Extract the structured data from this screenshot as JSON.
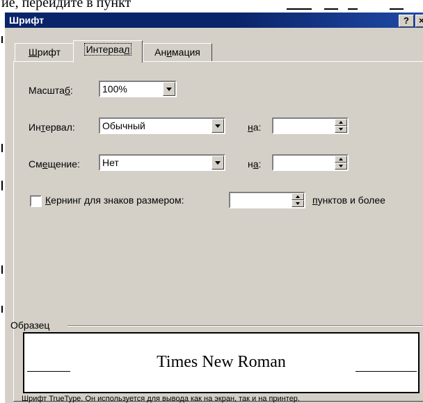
{
  "document": {
    "background_fragment": "ие, перейдите в пункт"
  },
  "dialog": {
    "title": "Шрифт",
    "help_glyph": "?",
    "close_glyph": "×"
  },
  "tabs": [
    {
      "label_pre": "",
      "label_u": "Ш",
      "label_post": "рифт",
      "active": false
    },
    {
      "label_pre": "Интерва",
      "label_u": "л",
      "label_post": "",
      "active": true
    },
    {
      "label_pre": "Ан",
      "label_u": "и",
      "label_post": "мация",
      "active": false
    }
  ],
  "scale": {
    "label_pre": "Масшта",
    "label_u": "б",
    "label_post": ":",
    "value": "100%"
  },
  "spacing": {
    "label_pre": "Ин",
    "label_u": "т",
    "label_post": "ервал:",
    "value": "Обычный",
    "by_pre": "",
    "by_u": "н",
    "by_post": "а:",
    "by_value": ""
  },
  "position": {
    "label_pre": "См",
    "label_u": "е",
    "label_post": "щение:",
    "value": "Нет",
    "by_pre": "н",
    "by_u": "а",
    "by_post": ":",
    "by_value": ""
  },
  "kerning": {
    "checked": false,
    "label_u": "К",
    "label_post": "ернинг для знаков размером:",
    "value": "",
    "suffix_u": "п",
    "suffix_post": "унктов и более"
  },
  "sample": {
    "group_label": "Образец",
    "preview_text": "Times New Roman",
    "footnote": "Шрифт TrueType. Он используется для вывода как на экран, так и на принтер."
  },
  "colors": {
    "titlebar": "#0a246a",
    "face": "#d4d0c8"
  }
}
